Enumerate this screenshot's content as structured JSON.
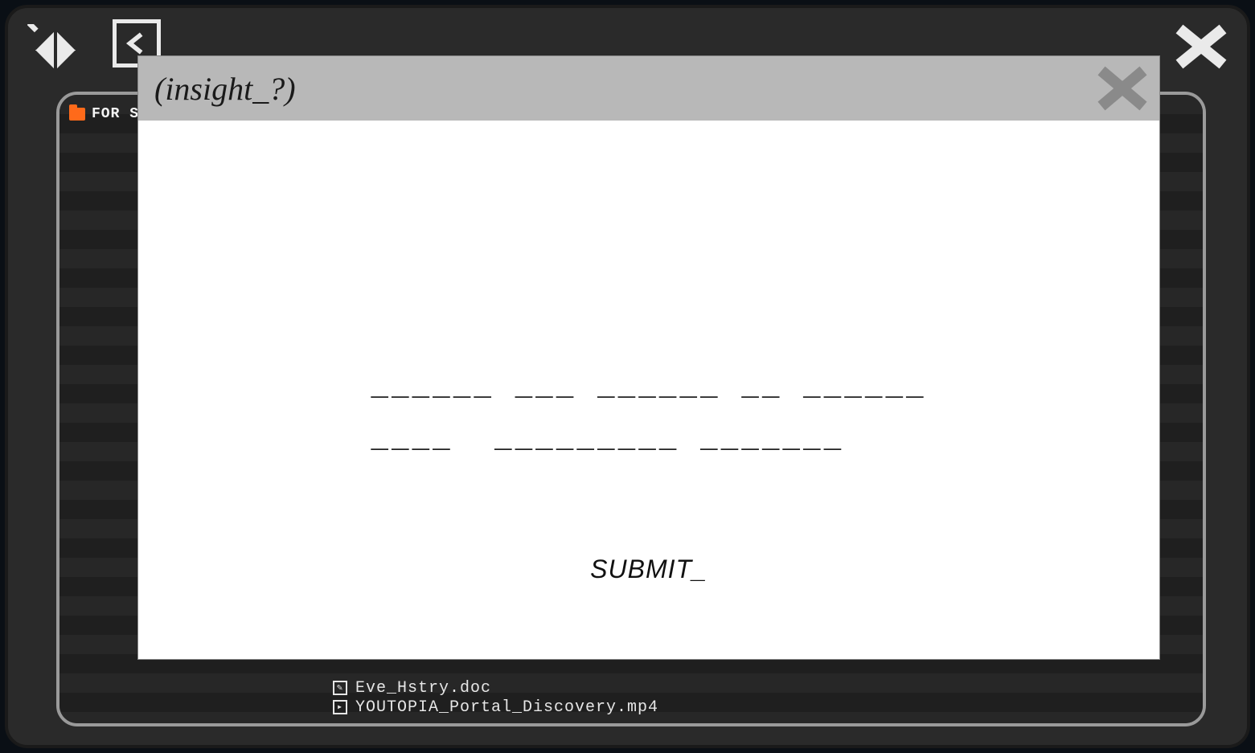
{
  "outer": {
    "folder_label": "FOR SOF"
  },
  "files": [
    {
      "name": "Eve_Hstry.doc",
      "type": "doc"
    },
    {
      "name": "YOUTOPIA_Portal_Discovery.mp4",
      "type": "vid"
    }
  ],
  "modal": {
    "title": "(insight_?)",
    "puzzle_line1": "______ ___ ______ __ ______",
    "puzzle_line2": "____  _________ _______",
    "submit_label": "SUBMIT_"
  }
}
